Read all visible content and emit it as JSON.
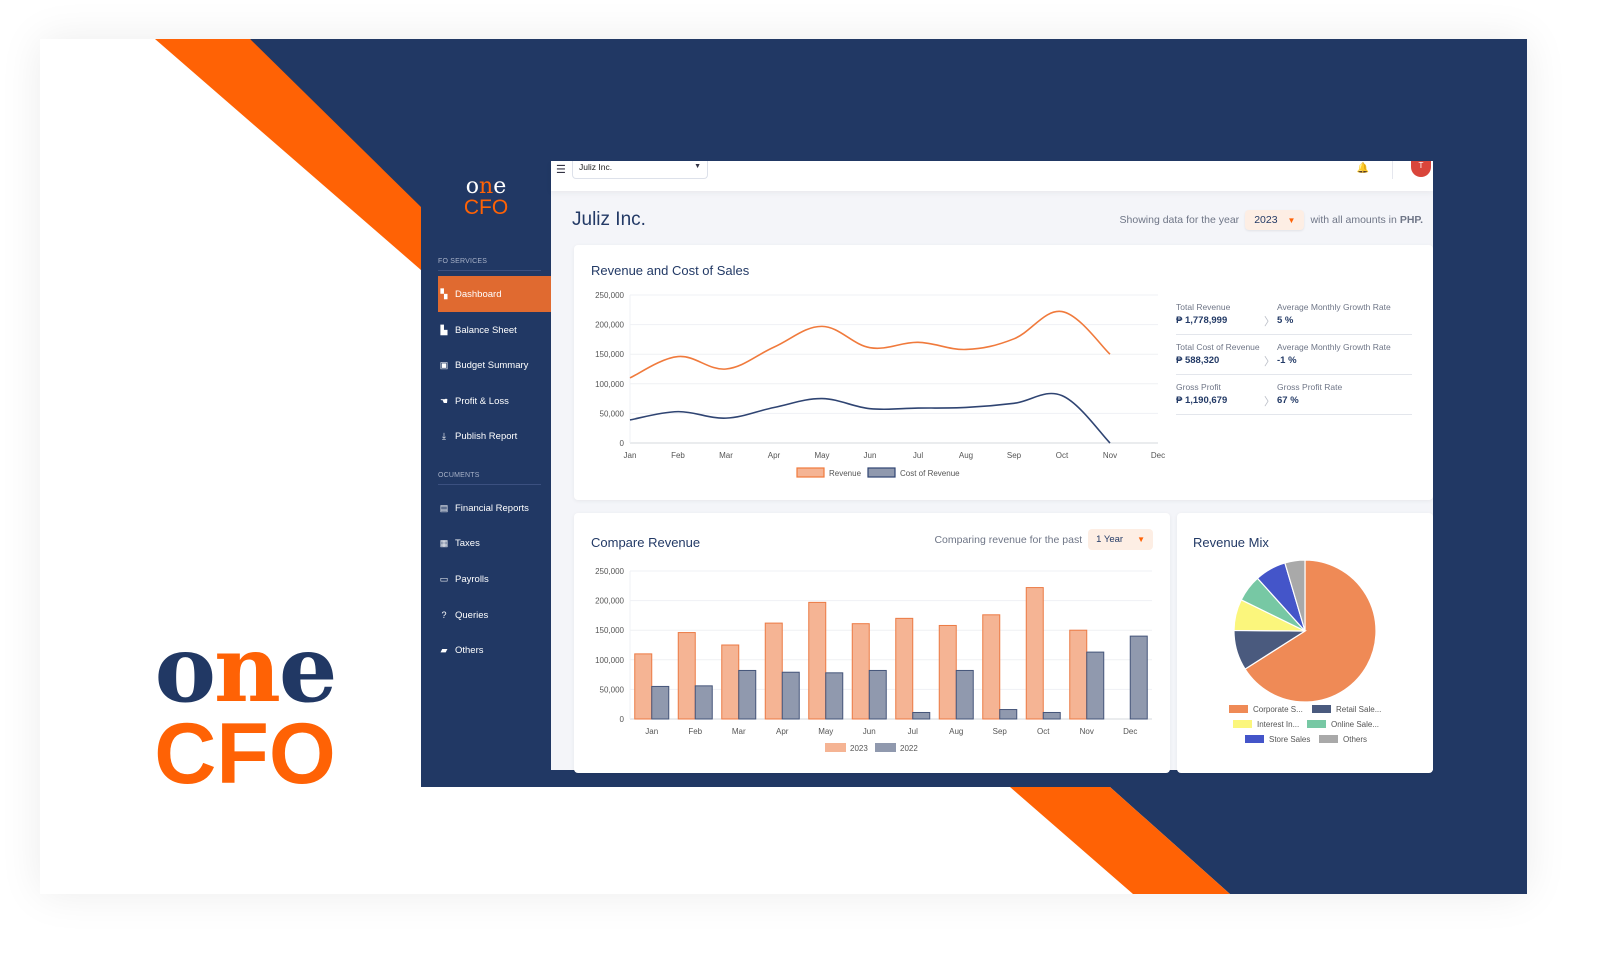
{
  "brand": {
    "one": "one",
    "one_o": "o",
    "one_n": "n",
    "one_e": "e",
    "cfo": "CFO",
    "orange": "#ff6205",
    "navy": "#213864"
  },
  "sidebar": {
    "section_services": "FO SERVICES",
    "section_documents": "OCUMENTS",
    "items": [
      {
        "label": "Dashboard",
        "icon": "dashboard-icon",
        "glyph": "▚",
        "active": true
      },
      {
        "label": "Balance Sheet",
        "icon": "balance-sheet-icon",
        "glyph": "▙"
      },
      {
        "label": "Budget Summary",
        "icon": "money-icon",
        "glyph": "▣"
      },
      {
        "label": "Profit & Loss",
        "icon": "hand-coin-icon",
        "glyph": "☚"
      },
      {
        "label": "Publish Report",
        "icon": "download-icon",
        "glyph": "⤓"
      },
      {
        "label": "Financial Reports",
        "icon": "report-file-icon",
        "glyph": "▤"
      },
      {
        "label": "Taxes",
        "icon": "calculator-icon",
        "glyph": "▦"
      },
      {
        "label": "Payrolls",
        "icon": "id-card-icon",
        "glyph": "▭"
      },
      {
        "label": "Queries",
        "icon": "question-icon",
        "glyph": "?"
      },
      {
        "label": "Others",
        "icon": "folder-icon",
        "glyph": "▰"
      }
    ]
  },
  "topbar": {
    "menu_glyph": "☰",
    "company": "Juliz Inc.",
    "bell_glyph": "🔔",
    "avatar_initial": "T"
  },
  "header": {
    "title": "Juliz Inc.",
    "year_prefix": "Showing data for the year",
    "year": "2023",
    "year_suffix": "with all amounts in",
    "currency": "PHP."
  },
  "revenue_card": {
    "title": "Revenue and Cost of Sales",
    "metrics": [
      {
        "label": "Total Revenue",
        "value": "₱ 1,778,999",
        "rate_label": "Average Monthly Growth Rate",
        "rate": "5 %"
      },
      {
        "label": "Total Cost of Revenue",
        "value": "₱ 588,320",
        "rate_label": "Average Monthly Growth Rate",
        "rate": "-1 %"
      },
      {
        "label": "Gross Profit",
        "value": "₱ 1,190,679",
        "rate_label": "Gross Profit Rate",
        "rate": "67 %"
      }
    ]
  },
  "compare_card": {
    "title": "Compare Revenue",
    "period_prefix": "Comparing revenue for the past",
    "period": "1 Year"
  },
  "mix_card": {
    "title": "Revenue Mix"
  },
  "chart_data": [
    {
      "type": "line",
      "title": "Revenue and Cost of Sales",
      "categories": [
        "Jan",
        "Feb",
        "Mar",
        "Apr",
        "May",
        "Jun",
        "Jul",
        "Aug",
        "Sep",
        "Oct",
        "Nov",
        "Dec"
      ],
      "yticks": [
        "0",
        "50,000",
        "100,000",
        "150,000",
        "200,000",
        "250,000"
      ],
      "ylim": [
        0,
        250000
      ],
      "grid": true,
      "legend": "bottom",
      "series": [
        {
          "name": "Revenue",
          "color": "#f07a3c",
          "values": [
            110000,
            146000,
            125000,
            162000,
            197000,
            161000,
            170000,
            158000,
            176000,
            222000,
            150000,
            null
          ]
        },
        {
          "name": "Cost of Revenue",
          "color": "#2f4472",
          "values": [
            39000,
            53000,
            42000,
            60000,
            75000,
            58000,
            59000,
            60000,
            67000,
            80000,
            0,
            null
          ]
        }
      ]
    },
    {
      "type": "bar",
      "title": "Compare Revenue",
      "categories": [
        "Jan",
        "Feb",
        "Mar",
        "Apr",
        "May",
        "Jun",
        "Jul",
        "Aug",
        "Sep",
        "Oct",
        "Nov",
        "Dec"
      ],
      "yticks": [
        "0",
        "50,000",
        "100,000",
        "150,000",
        "200,000",
        "250,000"
      ],
      "ylim": [
        0,
        250000
      ],
      "grid": true,
      "legend": "bottom",
      "series": [
        {
          "name": "2023",
          "fill": "#f5b494",
          "stroke": "#ec7a44",
          "values": [
            110000,
            146000,
            125000,
            162000,
            197000,
            161000,
            170000,
            158000,
            176000,
            222000,
            150000,
            0
          ]
        },
        {
          "name": "2022",
          "fill": "#9099ae",
          "stroke": "#45557a",
          "values": [
            55000,
            56000,
            82000,
            79000,
            78000,
            82000,
            11000,
            82000,
            16000,
            11000,
            113000,
            140000
          ]
        }
      ]
    },
    {
      "type": "pie",
      "title": "Revenue Mix",
      "legend": "bottom",
      "slices": [
        {
          "label": "Corporate S...",
          "value": 65,
          "color": "#ef8a56"
        },
        {
          "label": "Retail Sale...",
          "value": 9,
          "color": "#4a5a7e"
        },
        {
          "label": "Interest In...",
          "value": 7,
          "color": "#fbf67c"
        },
        {
          "label": "Online Sale...",
          "value": 6,
          "color": "#77c8a4"
        },
        {
          "label": "Store Sales",
          "value": 7,
          "color": "#4455c9"
        },
        {
          "label": "Others",
          "value": 4.5,
          "color": "#a9a9a9"
        }
      ]
    }
  ]
}
